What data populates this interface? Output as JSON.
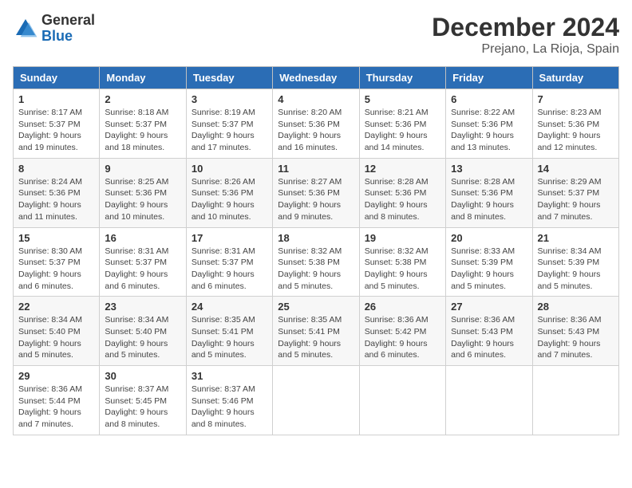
{
  "logo": {
    "general": "General",
    "blue": "Blue"
  },
  "header": {
    "month": "December 2024",
    "location": "Prejano, La Rioja, Spain"
  },
  "weekdays": [
    "Sunday",
    "Monday",
    "Tuesday",
    "Wednesday",
    "Thursday",
    "Friday",
    "Saturday"
  ],
  "weeks": [
    [
      {
        "day": 1,
        "sunrise": "8:17 AM",
        "sunset": "5:37 PM",
        "daylight": "9 hours and 19 minutes."
      },
      {
        "day": 2,
        "sunrise": "8:18 AM",
        "sunset": "5:37 PM",
        "daylight": "9 hours and 18 minutes."
      },
      {
        "day": 3,
        "sunrise": "8:19 AM",
        "sunset": "5:37 PM",
        "daylight": "9 hours and 17 minutes."
      },
      {
        "day": 4,
        "sunrise": "8:20 AM",
        "sunset": "5:36 PM",
        "daylight": "9 hours and 16 minutes."
      },
      {
        "day": 5,
        "sunrise": "8:21 AM",
        "sunset": "5:36 PM",
        "daylight": "9 hours and 14 minutes."
      },
      {
        "day": 6,
        "sunrise": "8:22 AM",
        "sunset": "5:36 PM",
        "daylight": "9 hours and 13 minutes."
      },
      {
        "day": 7,
        "sunrise": "8:23 AM",
        "sunset": "5:36 PM",
        "daylight": "9 hours and 12 minutes."
      }
    ],
    [
      {
        "day": 8,
        "sunrise": "8:24 AM",
        "sunset": "5:36 PM",
        "daylight": "9 hours and 11 minutes."
      },
      {
        "day": 9,
        "sunrise": "8:25 AM",
        "sunset": "5:36 PM",
        "daylight": "9 hours and 10 minutes."
      },
      {
        "day": 10,
        "sunrise": "8:26 AM",
        "sunset": "5:36 PM",
        "daylight": "9 hours and 10 minutes."
      },
      {
        "day": 11,
        "sunrise": "8:27 AM",
        "sunset": "5:36 PM",
        "daylight": "9 hours and 9 minutes."
      },
      {
        "day": 12,
        "sunrise": "8:28 AM",
        "sunset": "5:36 PM",
        "daylight": "9 hours and 8 minutes."
      },
      {
        "day": 13,
        "sunrise": "8:28 AM",
        "sunset": "5:36 PM",
        "daylight": "9 hours and 8 minutes."
      },
      {
        "day": 14,
        "sunrise": "8:29 AM",
        "sunset": "5:37 PM",
        "daylight": "9 hours and 7 minutes."
      }
    ],
    [
      {
        "day": 15,
        "sunrise": "8:30 AM",
        "sunset": "5:37 PM",
        "daylight": "9 hours and 6 minutes."
      },
      {
        "day": 16,
        "sunrise": "8:31 AM",
        "sunset": "5:37 PM",
        "daylight": "9 hours and 6 minutes."
      },
      {
        "day": 17,
        "sunrise": "8:31 AM",
        "sunset": "5:37 PM",
        "daylight": "9 hours and 6 minutes."
      },
      {
        "day": 18,
        "sunrise": "8:32 AM",
        "sunset": "5:38 PM",
        "daylight": "9 hours and 5 minutes."
      },
      {
        "day": 19,
        "sunrise": "8:32 AM",
        "sunset": "5:38 PM",
        "daylight": "9 hours and 5 minutes."
      },
      {
        "day": 20,
        "sunrise": "8:33 AM",
        "sunset": "5:39 PM",
        "daylight": "9 hours and 5 minutes."
      },
      {
        "day": 21,
        "sunrise": "8:34 AM",
        "sunset": "5:39 PM",
        "daylight": "9 hours and 5 minutes."
      }
    ],
    [
      {
        "day": 22,
        "sunrise": "8:34 AM",
        "sunset": "5:40 PM",
        "daylight": "9 hours and 5 minutes."
      },
      {
        "day": 23,
        "sunrise": "8:34 AM",
        "sunset": "5:40 PM",
        "daylight": "9 hours and 5 minutes."
      },
      {
        "day": 24,
        "sunrise": "8:35 AM",
        "sunset": "5:41 PM",
        "daylight": "9 hours and 5 minutes."
      },
      {
        "day": 25,
        "sunrise": "8:35 AM",
        "sunset": "5:41 PM",
        "daylight": "9 hours and 5 minutes."
      },
      {
        "day": 26,
        "sunrise": "8:36 AM",
        "sunset": "5:42 PM",
        "daylight": "9 hours and 6 minutes."
      },
      {
        "day": 27,
        "sunrise": "8:36 AM",
        "sunset": "5:43 PM",
        "daylight": "9 hours and 6 minutes."
      },
      {
        "day": 28,
        "sunrise": "8:36 AM",
        "sunset": "5:43 PM",
        "daylight": "9 hours and 7 minutes."
      }
    ],
    [
      {
        "day": 29,
        "sunrise": "8:36 AM",
        "sunset": "5:44 PM",
        "daylight": "9 hours and 7 minutes."
      },
      {
        "day": 30,
        "sunrise": "8:37 AM",
        "sunset": "5:45 PM",
        "daylight": "9 hours and 8 minutes."
      },
      {
        "day": 31,
        "sunrise": "8:37 AM",
        "sunset": "5:46 PM",
        "daylight": "9 hours and 8 minutes."
      },
      null,
      null,
      null,
      null
    ]
  ]
}
